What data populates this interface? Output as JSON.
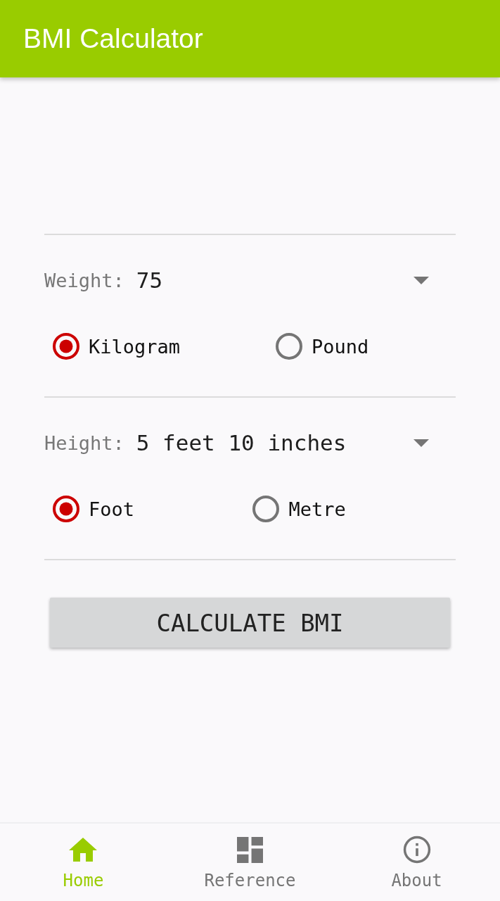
{
  "app_bar": {
    "title": "BMI Calculator"
  },
  "measurements": [
    {
      "label": "Weight:",
      "value": "75",
      "units": [
        {
          "label": "Kilogram",
          "selected": true
        },
        {
          "label": "Pound",
          "selected": false
        }
      ]
    },
    {
      "label": "Height:",
      "value": "5 feet 10 inches",
      "units": [
        {
          "label": "Foot",
          "selected": true
        },
        {
          "label": "Metre",
          "selected": false
        }
      ]
    }
  ],
  "calculate_button": {
    "label": "CALCULATE BMI"
  },
  "bottom_nav": [
    {
      "label": "Home",
      "selected": true
    },
    {
      "label": "Reference",
      "selected": false
    },
    {
      "label": "About",
      "selected": false
    }
  ]
}
